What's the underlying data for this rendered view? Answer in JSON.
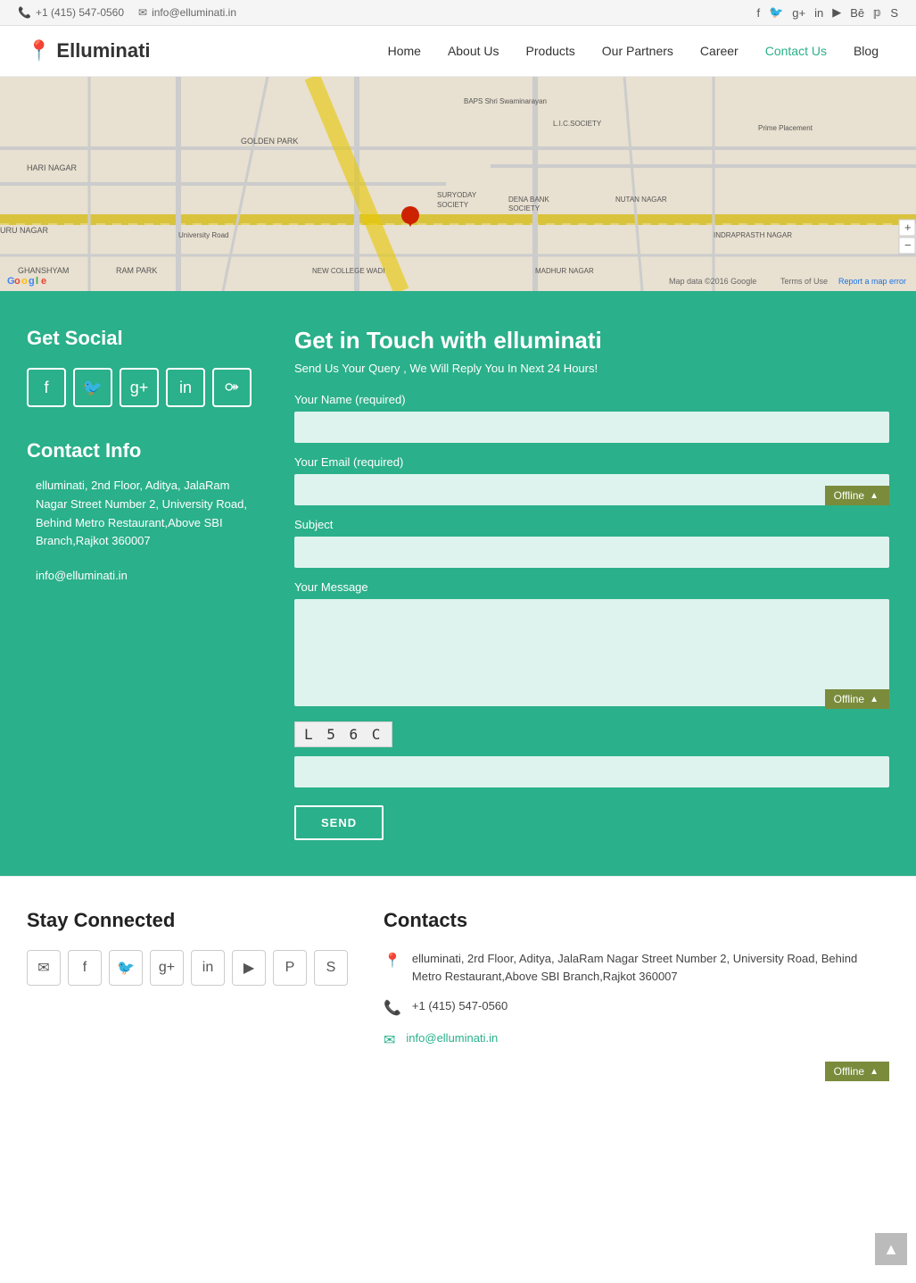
{
  "topbar": {
    "phone": "+1 (415) 547-0560",
    "email": "info@elluminati.in"
  },
  "header": {
    "logo_text": "Elluminati",
    "nav_items": [
      {
        "label": "Home",
        "active": false
      },
      {
        "label": "About Us",
        "active": false
      },
      {
        "label": "Products",
        "active": false
      },
      {
        "label": "Our Partners",
        "active": false
      },
      {
        "label": "Career",
        "active": false
      },
      {
        "label": "Contact Us",
        "active": true
      },
      {
        "label": "Blog",
        "active": false
      }
    ]
  },
  "main_section": {
    "get_social_title": "Get Social",
    "contact_info_title": "Contact Info",
    "address": "elluminati, 2nd Floor, Aditya, JalaRam Nagar Street Number 2, University Road, Behind Metro Restaurant,Above SBI Branch,Rajkot 360007",
    "contact_email": "info@elluminati.in",
    "form_title": "Get in Touch with elluminati",
    "form_subtitle": "Send Us Your Query , We Will Reply You In Next 24 Hours!",
    "name_label": "Your Name (required)",
    "email_label": "Your Email (required)",
    "subject_label": "Subject",
    "message_label": "Your Message",
    "captcha_text": "L 5 6 C",
    "send_label": "SEND",
    "offline_label": "Offline"
  },
  "footer": {
    "stay_connected_title": "Stay Connected",
    "contacts_title": "Contacts",
    "footer_address": "elluminati, 2rd Floor, Aditya, JalaRam Nagar Street Number 2, University Road, Behind Metro Restaurant,Above SBI Branch,Rajkot 360007",
    "footer_phone": "+1 (415) 547-0560",
    "footer_email": "info@elluminati.in"
  },
  "social_icons": {
    "facebook": "f",
    "twitter": "t",
    "googleplus": "g+",
    "linkedin": "in",
    "pinterest": "p"
  },
  "map": {
    "alt": "Map showing Rajkot location"
  }
}
